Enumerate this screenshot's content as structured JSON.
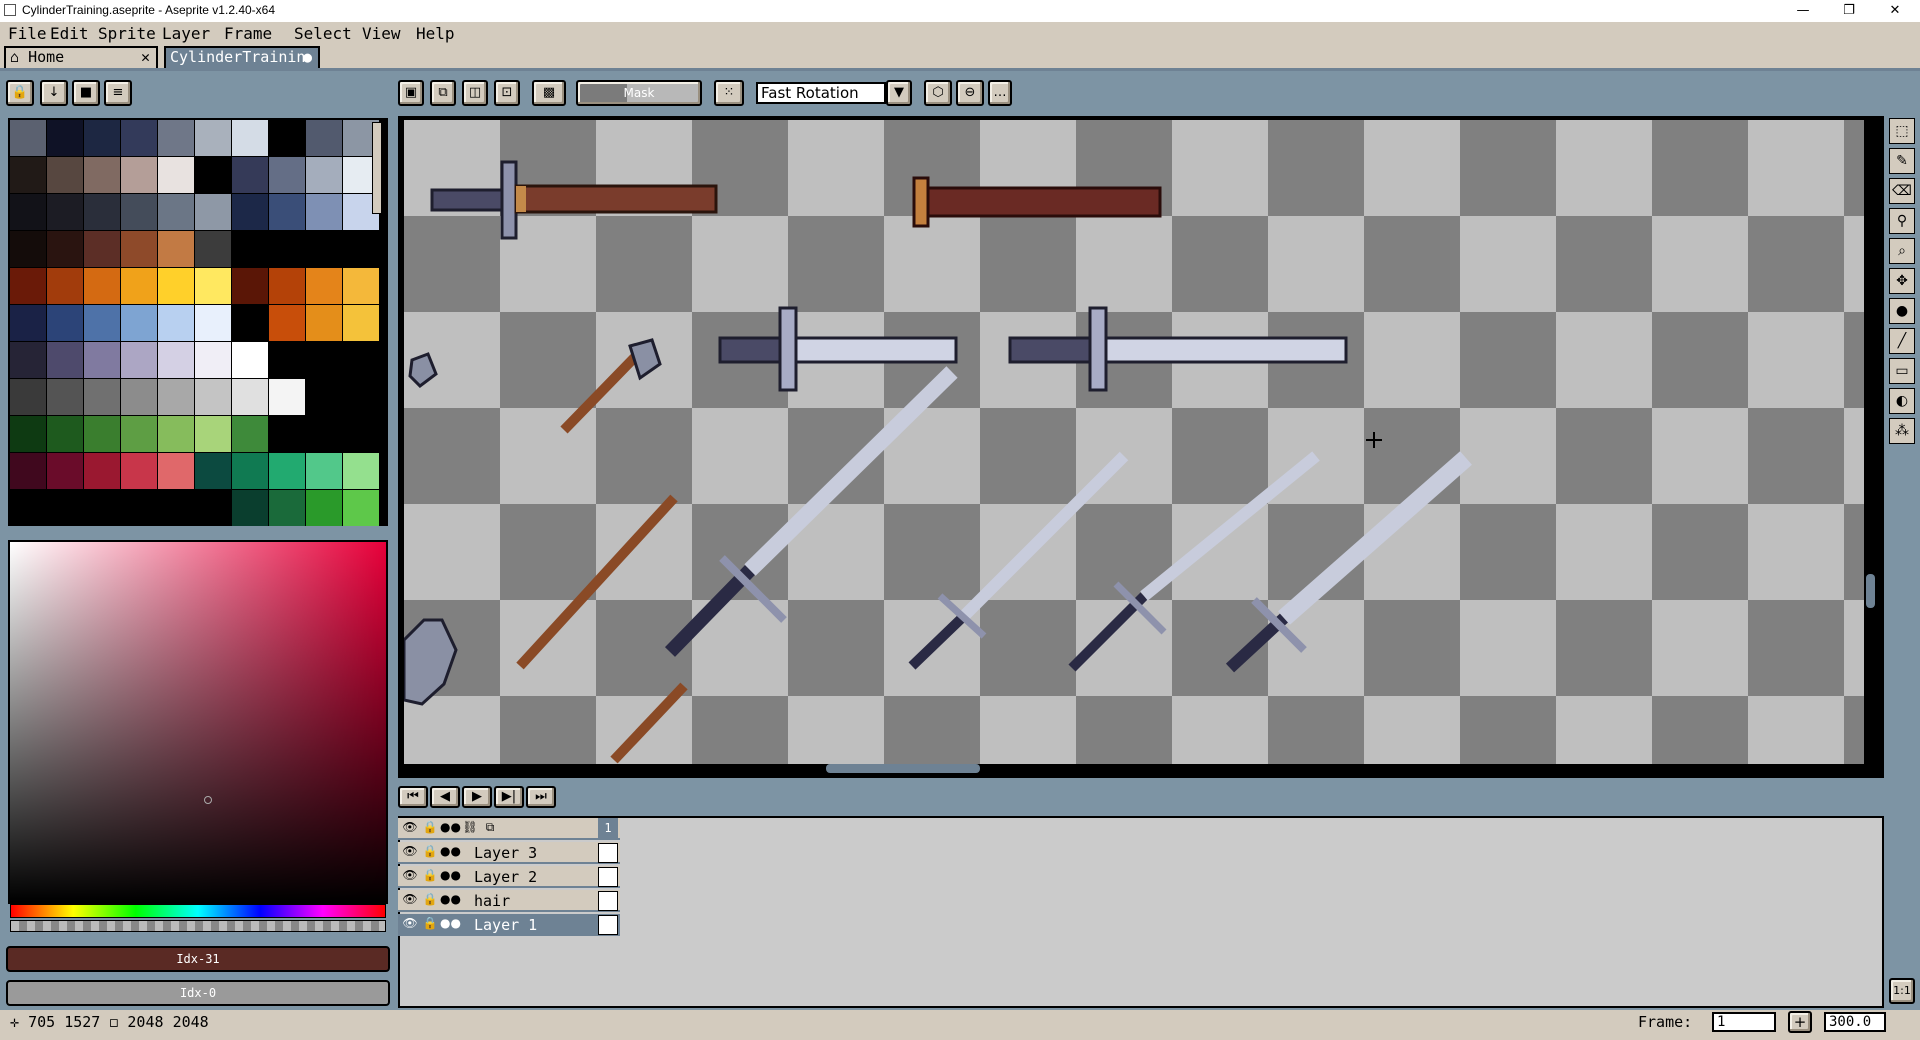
{
  "window": {
    "title": "CylinderTraining.aseprite - Aseprite v1.2.40-x64",
    "minimize": "—",
    "maximize": "❐",
    "close": "✕"
  },
  "menu": [
    "File",
    "Edit",
    "Sprite",
    "Layer",
    "Frame",
    "Select",
    "View",
    "Help"
  ],
  "tabs": {
    "home": "Home",
    "file": "CylinderTrainin"
  },
  "context_bar": {
    "mask_label": "Mask",
    "rotation_algorithm": "Fast Rotation"
  },
  "colors": {
    "fg_label": "Idx-31",
    "bg_label": "Idx-0",
    "palette": [
      [
        "#5b6170",
        "#0f1226",
        "#1d2742",
        "#333a5a",
        "#6f7788",
        "#a9b1bc",
        "#d4dce6",
        "#000000",
        "#525a6e",
        "#8c96a4"
      ],
      [
        "#211a17",
        "#574740",
        "#806a62",
        "#b49e98",
        "#e8e2e0",
        "#000000",
        "#353a58",
        "#646e86",
        "#a4adbc",
        "#e6ecf2"
      ],
      [
        "#121218",
        "#1c1c24",
        "#2a2e3a",
        "#444c5a",
        "#6b7686",
        "#8e98a6",
        "#1c2848",
        "#3a4e78",
        "#7e90b4",
        "#c8d4ec"
      ],
      [
        "#140c0a",
        "#2a1410",
        "#5c2e26",
        "#8e4a2a",
        "#c27a44",
        "#3c3c3c",
        "#000000",
        "#000000",
        "#000000",
        "#000000"
      ],
      [
        "#6a1a08",
        "#a23c0c",
        "#d46a12",
        "#f0a21a",
        "#ffd02a",
        "#ffe860",
        "#5a1606",
        "#b44208",
        "#e4841a",
        "#f4b83a"
      ],
      [
        "#1a2246",
        "#2c4478",
        "#4e72a8",
        "#7ea4d2",
        "#b8d0f0",
        "#e8f0fc",
        "#000000",
        "#c84e0a",
        "#e48e1a",
        "#f4c23a"
      ],
      [
        "#262436",
        "#4e4a6c",
        "#807aa0",
        "#aca6c4",
        "#d4d0e4",
        "#f0eef6",
        "#ffffff",
        "#000000",
        "#000000",
        "#000000"
      ],
      [
        "#3a3a3a",
        "#545454",
        "#707070",
        "#8c8c8c",
        "#a8a8a8",
        "#c4c4c4",
        "#e0e0e0",
        "#f4f4f4",
        "#000000",
        "#000000"
      ],
      [
        "#0e3a12",
        "#1e5a1e",
        "#3a7e2e",
        "#5e9e44",
        "#86bc5c",
        "#a8d47a",
        "#3e8a3a",
        "#000000",
        "#000000",
        "#000000"
      ],
      [
        "#40081e",
        "#6a0c2a",
        "#9a1830",
        "#c8364a",
        "#e0686a",
        "#0c4a40",
        "#107a52",
        "#22aa70",
        "#52c88a",
        "#94e08e"
      ],
      [
        "#000000",
        "#000000",
        "#000000",
        "#000000",
        "#000000",
        "#000000",
        "#0a3e2e",
        "#1a6a3a",
        "#2a9a2a",
        "#5ec84a"
      ]
    ]
  },
  "canvas": {
    "zoom_percent": 300
  },
  "layers": [
    {
      "name": "Layer 3"
    },
    {
      "name": "Layer 2"
    },
    {
      "name": "hair"
    },
    {
      "name": "Layer 1"
    }
  ],
  "timeline": {
    "frame_header": "1"
  },
  "status": {
    "cursor_x": "705",
    "cursor_y": "1527",
    "sprite_w": "2048",
    "sprite_h": "2048",
    "frame_label": "Frame:",
    "frame_value": "1",
    "add_frame": "+",
    "zoom_value": "300.0",
    "actual_size": "1:1"
  }
}
